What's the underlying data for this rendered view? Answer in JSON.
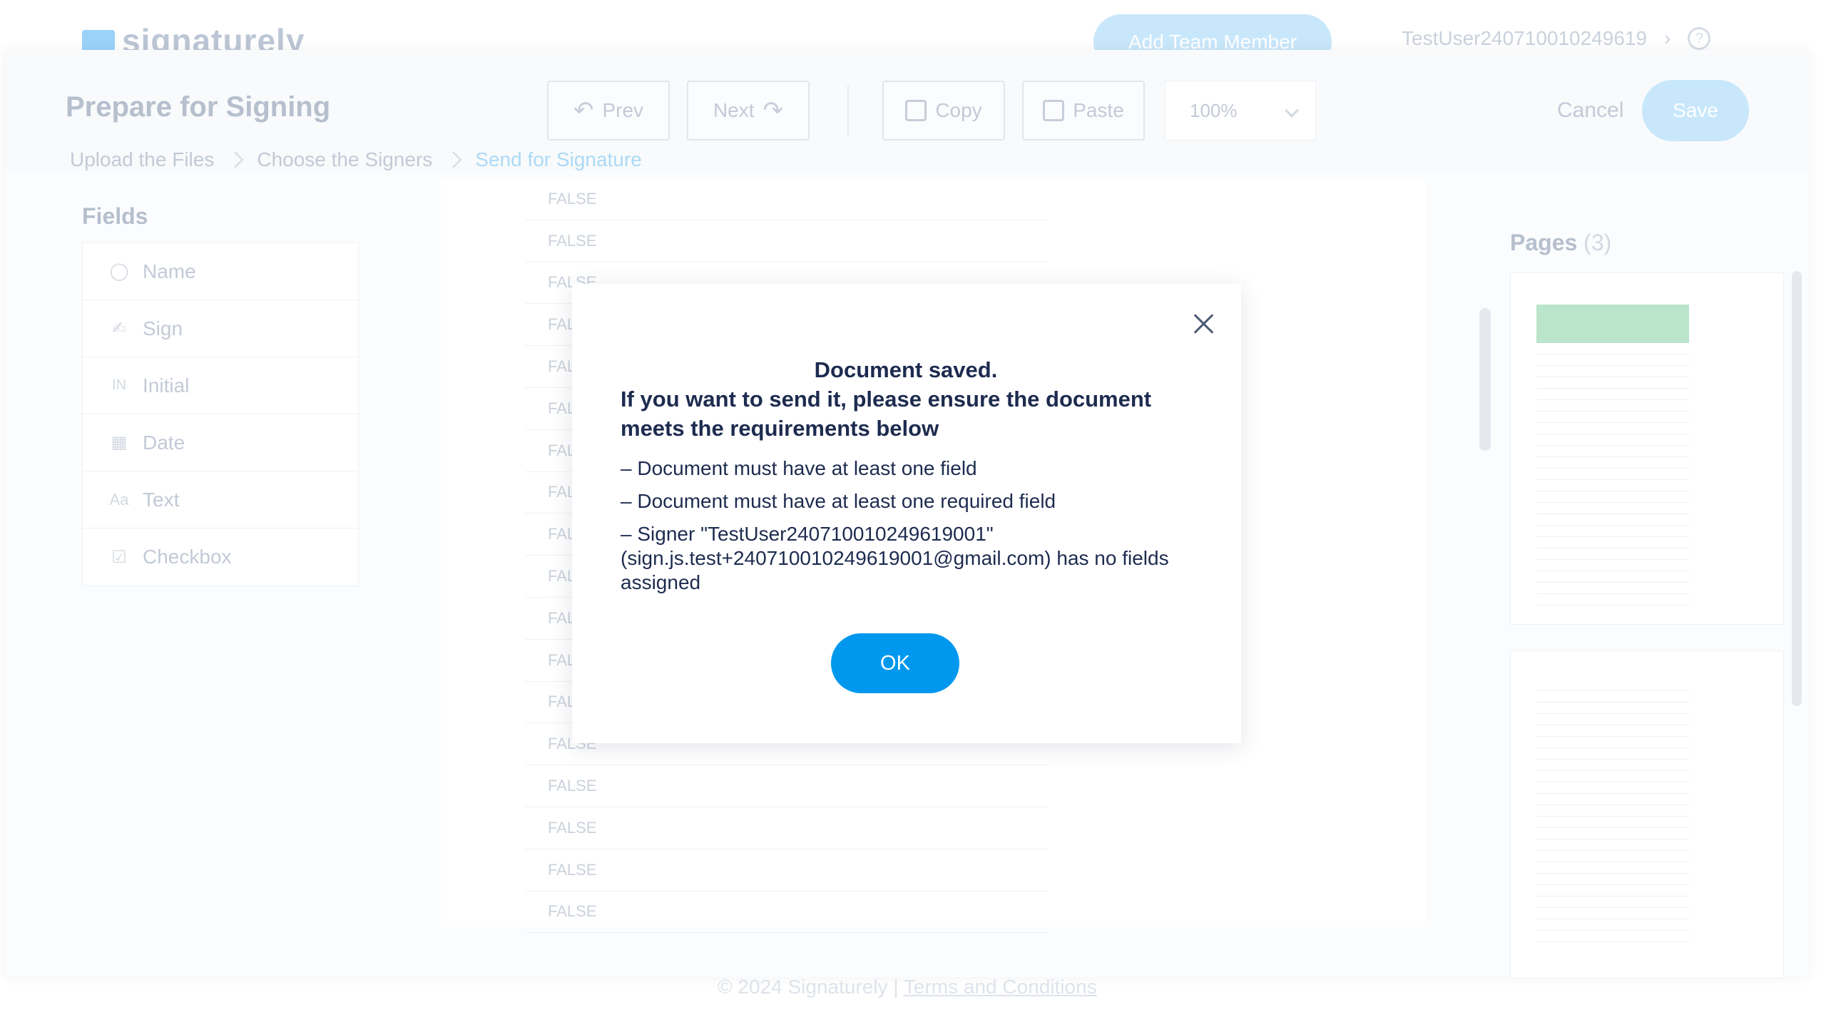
{
  "header": {
    "logo_text": "signaturely",
    "add_team_label": "Add Team Member",
    "user_name": "TestUser240710010249619",
    "help_glyph": "?"
  },
  "toolbar": {
    "title": "Prepare for Signing",
    "prev_label": "Prev",
    "next_label": "Next",
    "copy_label": "Copy",
    "paste_label": "Paste",
    "zoom_value": "100%",
    "cancel_label": "Cancel",
    "save_label": "Save"
  },
  "breadcrumb": {
    "items": [
      "Upload the Files",
      "Choose the Signers",
      "Send for Signature"
    ]
  },
  "fields": {
    "title": "Fields",
    "items": [
      {
        "label": "Name",
        "icon": "user-icon"
      },
      {
        "label": "Sign",
        "icon": "signature-icon"
      },
      {
        "label": "Initial",
        "icon": "initials-icon"
      },
      {
        "label": "Date",
        "icon": "calendar-icon"
      },
      {
        "label": "Text",
        "icon": "text-icon"
      },
      {
        "label": "Checkbox",
        "icon": "checkbox-icon"
      }
    ]
  },
  "document": {
    "rows": [
      "FALSE",
      "FALSE",
      "FALSE",
      "FALSE",
      "FALSE",
      "FALSE",
      "FALSE",
      "FALSE",
      "FALSE",
      "FALSE",
      "FALSE",
      "FALSE",
      "FALSE",
      "FALSE",
      "FALSE",
      "FALSE",
      "FALSE",
      "FALSE"
    ]
  },
  "pages": {
    "title": "Pages",
    "count": "(3)"
  },
  "footer": {
    "copyright": "© 2024 Signaturely |",
    "terms_link": "Terms and Conditions"
  },
  "modal": {
    "heading_line1": "Document saved.",
    "heading_line2": "If you want to send it, please ensure the document meets the requirements below",
    "requirements": [
      "– Document must have at least one field",
      "– Document must have at least one required field",
      "– Signer \"TestUser240710010249619001\" (sign.js.test+240710010249619001@gmail.com) has no fields assigned"
    ],
    "ok_label": "OK"
  }
}
